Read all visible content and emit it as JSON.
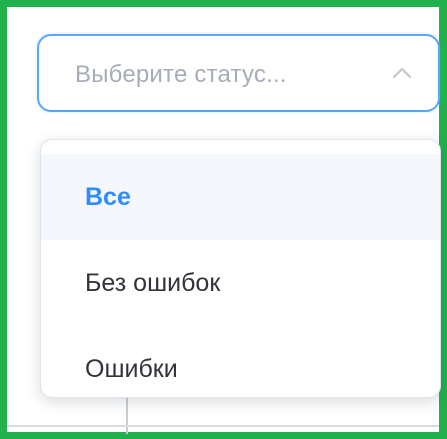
{
  "status_select": {
    "placeholder": "Выберите статус...",
    "expanded": true,
    "icon": "chevron-up-icon",
    "border_color": "#5aa6ff"
  },
  "dropdown": {
    "options": [
      {
        "label": "Все",
        "selected": true
      },
      {
        "label": "Без ошибок",
        "selected": false
      },
      {
        "label": "Ошибки",
        "selected": false
      }
    ],
    "selected_color": "#2f8cff",
    "selected_background": "#f4f7fb"
  },
  "frame": {
    "highlight_color": "#22b14c"
  }
}
